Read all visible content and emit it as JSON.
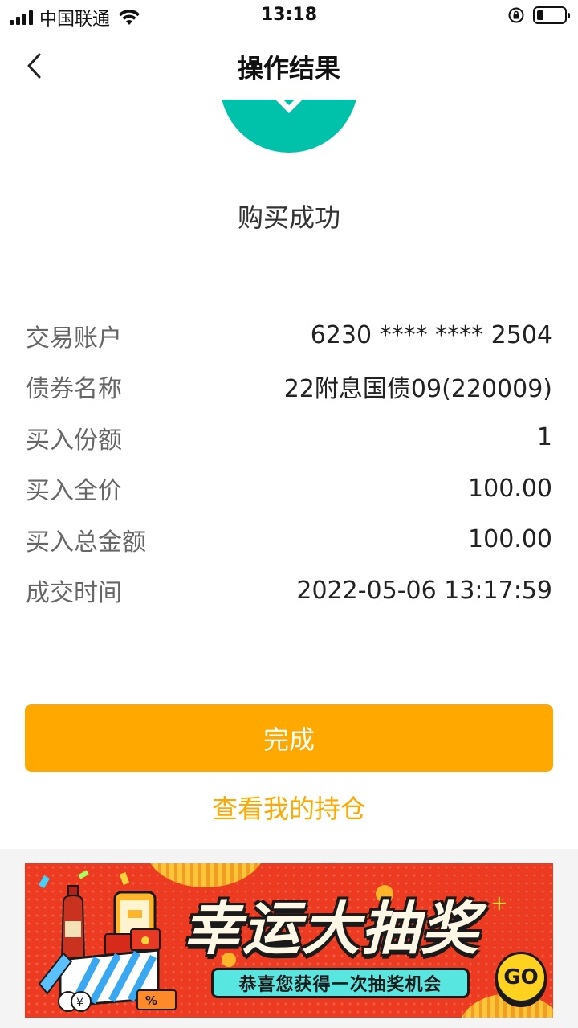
{
  "status_bar": {
    "carrier": "中国联通",
    "time": "13:18"
  },
  "nav": {
    "title": "操作结果"
  },
  "result": {
    "title": "购买成功",
    "icon_color": "#00c2aa"
  },
  "details": [
    {
      "label": "交易账户",
      "value": "6230 **** **** 2504"
    },
    {
      "label": "债券名称",
      "value": "22附息国债09(220009)"
    },
    {
      "label": "买入份额",
      "value": "1"
    },
    {
      "label": "买入全价",
      "value": "100.00"
    },
    {
      "label": "买入总金额",
      "value": "100.00"
    },
    {
      "label": "成交时间",
      "value": "2022-05-06 13:17:59"
    }
  ],
  "actions": {
    "done_label": "完成",
    "holdings_label": "查看我的持仓",
    "accent_color": "#ffa800"
  },
  "banner": {
    "title": "幸运大抽奖",
    "subtitle": "恭喜您获得一次抽奖机会",
    "go_label": "GO",
    "icons": [
      "wine-bottle-icon",
      "phone-icon",
      "gift-box-icon",
      "coin-icon",
      "red-envelope-icon",
      "coupon-icon"
    ]
  }
}
